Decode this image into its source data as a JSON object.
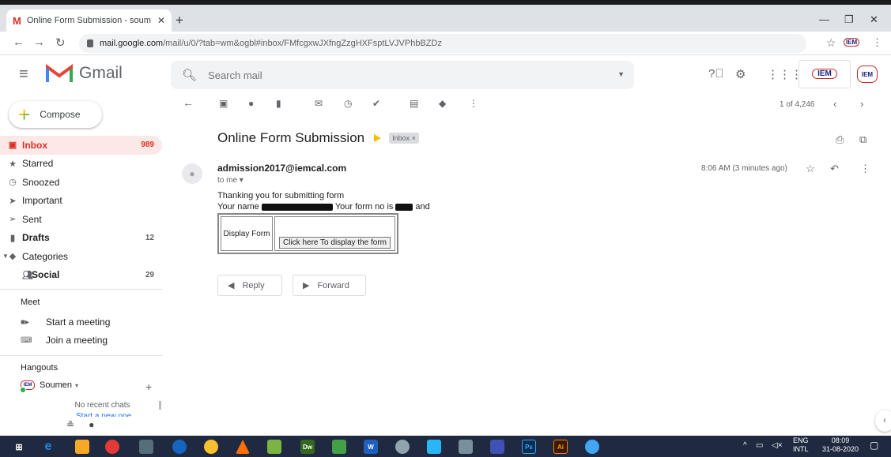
{
  "browser": {
    "tab_title": "Online Form Submission - soum",
    "tab_favicon": "M",
    "url_host": "mail.google.com",
    "url_path": "/mail/u/0/?tab=wm&ogbl#inbox/FMfcgxwJXfngZzgHXFsptLVJVPhbBZDz",
    "ext_label": "IEM"
  },
  "header": {
    "app_name": "Gmail",
    "search_placeholder": "Search mail",
    "org_logo_text": "IEM",
    "org_logo_sub": "",
    "avatar_text": "IEM"
  },
  "compose": {
    "label": "Compose"
  },
  "sidebar": {
    "items": [
      {
        "label": "Inbox",
        "count": "989",
        "icon": "inbox-icon"
      },
      {
        "label": "Starred",
        "count": "",
        "icon": "star-icon"
      },
      {
        "label": "Snoozed",
        "count": "",
        "icon": "clock-icon"
      },
      {
        "label": "Important",
        "count": "",
        "icon": "important-icon"
      },
      {
        "label": "Sent",
        "count": "",
        "icon": "send-icon"
      },
      {
        "label": "Drafts",
        "count": "12",
        "icon": "draft-icon"
      },
      {
        "label": "Categories",
        "count": "",
        "icon": "label-icon"
      },
      {
        "label": "Social",
        "count": "29",
        "icon": "people-icon"
      }
    ]
  },
  "meet": {
    "heading": "Meet",
    "start": "Start a meeting",
    "join": "Join a meeting"
  },
  "hangouts": {
    "heading": "Hangouts",
    "user": "Soumen",
    "user_avatar": "IEM",
    "no_chats": "No recent chats",
    "start_new": "Start a new one"
  },
  "toolbar": {
    "pager": "1 of 4,246"
  },
  "email": {
    "subject": "Online Form Submission",
    "label": "Inbox",
    "sender": "admission2017@iemcal.com",
    "to": "to me",
    "time": "8:06 AM (3 minutes ago)",
    "line1": "Thanking you for submitting form",
    "name_prefix": "Your name",
    "form_no_prefix": "Your form no is",
    "suffix": "and",
    "table_label": "Display Form",
    "table_button": "Click here To display the form"
  },
  "actions": {
    "reply": "Reply",
    "forward": "Forward"
  },
  "taskbar": {
    "apps": [
      "Dw",
      "W",
      "Ps",
      "Ai"
    ],
    "lang_top": "ENG",
    "lang_bottom": "INTL",
    "time": "08:09",
    "date": "31-08-2020"
  },
  "colors": {
    "accent_red": "#d93025",
    "inbox_bg": "#fce8e6",
    "taskbar": "#1f2a40"
  }
}
